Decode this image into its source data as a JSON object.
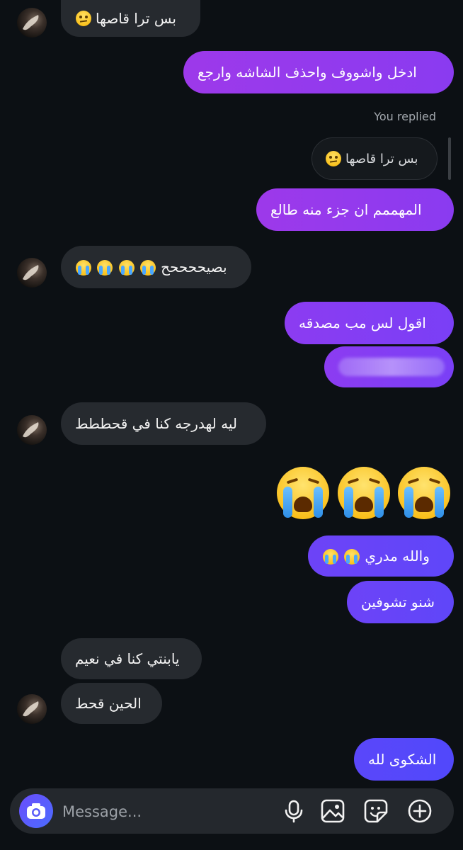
{
  "messages": {
    "m1": "بس ترا قاصها",
    "m2": "ادخل واشووف واحذف الشاشه وارجع",
    "replied_label": "You replied",
    "quoted": "بس ترا قاصها",
    "m3": "المهممم ان جزء منه طالع",
    "m4": "بصيححححح",
    "m5": "اقول لس مب مصدقه",
    "m6": "ليه لهدرجه كنا في قحططط",
    "m7": "والله مدري",
    "m8": "شنو تشوفين",
    "m9": "يابنتي كنا في نعيم",
    "m10": "الحين قحط",
    "m11": "الشكوى لله"
  },
  "composer": {
    "placeholder": "Message..."
  },
  "icons": {
    "camera": "camera-icon",
    "microphone": "microphone-icon",
    "gallery": "gallery-icon",
    "sticker": "sticker-icon",
    "plus": "plus-circle-icon"
  },
  "colors": {
    "background": "#0c1014",
    "incoming_bubble": "#262a2f",
    "outgoing_top": "#9d39ea",
    "outgoing_bottom": "#5148fb"
  }
}
